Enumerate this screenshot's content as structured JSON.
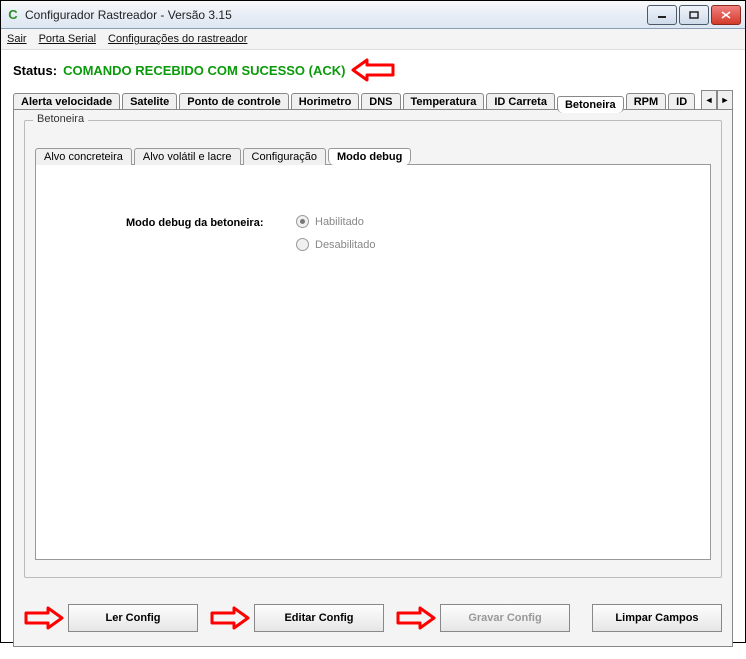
{
  "window": {
    "title": "Configurador Rastreador - Versão 3.15",
    "icon": "C"
  },
  "menu": {
    "items": [
      "Sair",
      "Porta Serial",
      "Configurações do rastreador"
    ]
  },
  "status": {
    "label": "Status:",
    "value": "COMANDO RECEBIDO COM SUCESSO (ACK)"
  },
  "main_tabs": {
    "items": [
      {
        "label": "Alerta velocidade"
      },
      {
        "label": "Satelite"
      },
      {
        "label": "Ponto de controle"
      },
      {
        "label": "Horimetro"
      },
      {
        "label": "DNS"
      },
      {
        "label": "Temperatura"
      },
      {
        "label": "ID Carreta"
      },
      {
        "label": "Betoneira",
        "active": true,
        "highlight": true
      },
      {
        "label": "RPM"
      },
      {
        "label": "ID"
      }
    ]
  },
  "groupbox": {
    "legend": "Betoneira"
  },
  "inner_tabs": {
    "items": [
      {
        "label": "Alvo concreteira"
      },
      {
        "label": "Alvo volátil e lacre"
      },
      {
        "label": "Configuração"
      },
      {
        "label": "Modo debug",
        "active": true,
        "highlight": true
      }
    ]
  },
  "form": {
    "label": "Modo debug da betoneira:",
    "options": [
      {
        "label": "Habilitado",
        "selected": true
      },
      {
        "label": "Desabilitado",
        "selected": false
      }
    ]
  },
  "buttons": {
    "ler": "Ler Config",
    "editar": "Editar Config",
    "gravar": "Gravar Config",
    "limpar": "Limpar Campos"
  }
}
